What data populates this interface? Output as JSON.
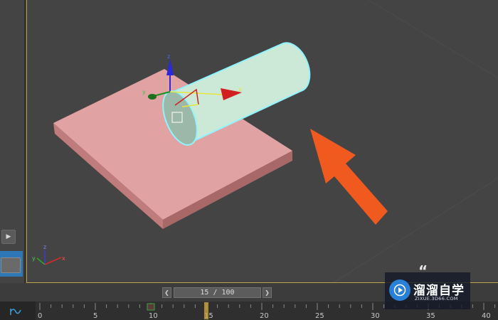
{
  "timeline": {
    "frame_counter": "15 / 100",
    "current_frame": 15,
    "total_frames": 100,
    "ruler_labels": [
      "0",
      "5",
      "10",
      "15",
      "20",
      "25",
      "30",
      "35",
      "40"
    ]
  },
  "gizmo": {
    "axis_z": "z",
    "axis_y": "y",
    "axis_x": "x"
  },
  "corner_axis": {
    "axis_z": "z",
    "axis_y": "y",
    "axis_x": "x"
  },
  "watermark": {
    "title": "溜溜自学",
    "url": "ZIXUE.3D66.COM"
  },
  "colors": {
    "viewport_background": "#444444",
    "viewport_border": "#bfa34a",
    "plane": "#d98a8a",
    "cylinder": "#c8e6d4",
    "selection_outline": "#8ff4ff",
    "arrow": "#f05a1e",
    "axis_x": "#d02020",
    "axis_y": "#1f8f1f",
    "axis_z": "#2a2ad8",
    "playhead": "#c9a23c",
    "panel_tab": "#2e78b8",
    "badge_logo": "#2a7fd6"
  },
  "icons": {
    "expand_panel": "triangle-right-icon",
    "prev_frame": "chevron-left-icon",
    "next_frame": "chevron-right-icon",
    "track_mode": "curve-icon",
    "pointer": "arrow-annotation-icon"
  }
}
